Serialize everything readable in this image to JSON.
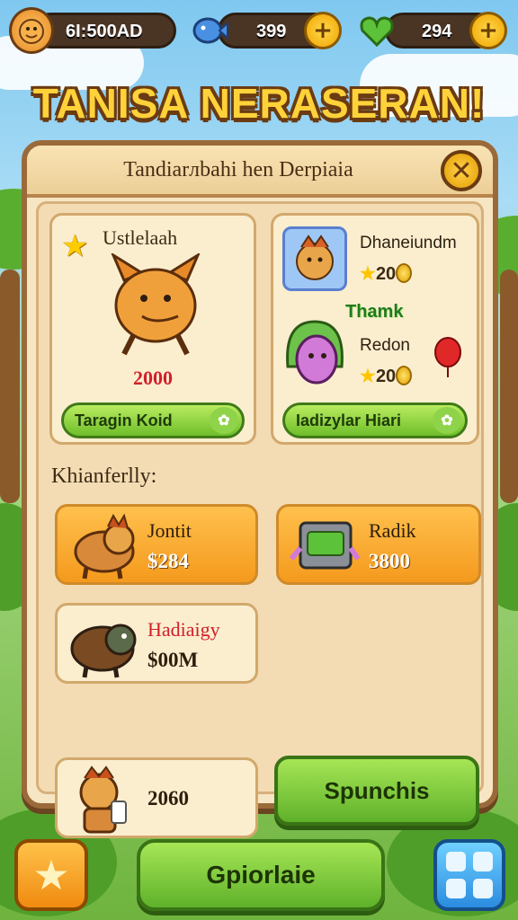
{
  "top_bar": {
    "currency_1": "6I:500AD",
    "currency_2": "399",
    "currency_3": "294"
  },
  "title": "TANISA NERASERAN!",
  "panel": {
    "title": "Tandiarлbahi hen Derpiaia",
    "featured": {
      "name": "Ustlelaah",
      "price": "2000",
      "button": "Taragin Koid"
    },
    "duo": {
      "item_1_name": "Dhaneiundm",
      "item_1_cost": "20",
      "tag": "Thamk",
      "item_2_name": "Redon",
      "item_2_cost": "20",
      "button": "Iadizylar Hiari"
    },
    "section_label": "Khianferlly:",
    "offers": [
      {
        "name": "Jontit",
        "price": "$284"
      },
      {
        "name": "Radik",
        "price": "3800"
      },
      {
        "name": "Hadiaigy",
        "price": "$00M"
      },
      {
        "name": "",
        "price": "2060"
      }
    ],
    "spin_button": "Spunchis"
  },
  "bottom_bar": {
    "main_button": "Gpiorlaie"
  },
  "colors": {
    "accent_green": "#6fbe2b",
    "accent_orange": "#f49a1d",
    "title_yellow": "#ffd23a",
    "panel_bg": "#f7e6c4",
    "price_red": "#d1202a"
  },
  "icons": [
    "avatar-icon",
    "fish-icon",
    "heart-icon",
    "plus-icon",
    "close-icon",
    "star-icon",
    "coin-icon",
    "grid-icon"
  ]
}
